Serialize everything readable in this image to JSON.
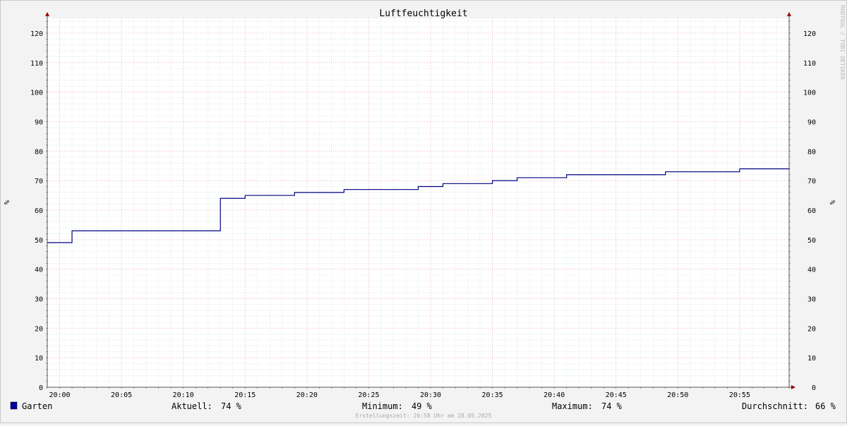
{
  "chart_data": {
    "type": "line",
    "title": "Luftfeuchtigkeit",
    "ylabel": "%",
    "ylabel_right": "%",
    "ylim": [
      0,
      125
    ],
    "yticks": [
      0,
      10,
      20,
      30,
      40,
      50,
      60,
      70,
      80,
      90,
      100,
      110,
      120
    ],
    "xlim": [
      "19:59",
      "20:59"
    ],
    "xticks": [
      "20:00",
      "20:05",
      "20:10",
      "20:15",
      "20:20",
      "20:25",
      "20:30",
      "20:35",
      "20:40",
      "20:45",
      "20:50",
      "20:55"
    ],
    "grid": true,
    "step": true,
    "series": [
      {
        "name": "Garten",
        "color": "#000080",
        "x": [
          "19:59",
          "20:01",
          "20:13",
          "20:15",
          "20:19",
          "20:23",
          "20:29",
          "20:31",
          "20:35",
          "20:37",
          "20:41",
          "20:49",
          "20:55",
          "20:59"
        ],
        "y": [
          49,
          53,
          64,
          65,
          66,
          67,
          68,
          69,
          70,
          71,
          72,
          73,
          74,
          74
        ]
      }
    ],
    "watermark": "RRDTOOL / TOBI OETIKER"
  },
  "legend": {
    "series_name": "Garten",
    "swatch_color": "#0000a0",
    "current_label": "Aktuell:",
    "current_value": "74 %",
    "min_label": "Minimum:",
    "min_value": "49 %",
    "max_label": "Maximum:",
    "max_value": "74 %",
    "avg_label": "Durchschnitt:",
    "avg_value": "66 %"
  },
  "footer": "Erstellungszeit: 20:58 Uhr am 28.05.2025",
  "colors": {
    "background": "#f3f3f3",
    "plot_background": "#ffffff",
    "major_grid": "#e8a0a0",
    "minor_grid": "#c8d8d8",
    "axis": "#555555",
    "arrow": "#a00000"
  }
}
